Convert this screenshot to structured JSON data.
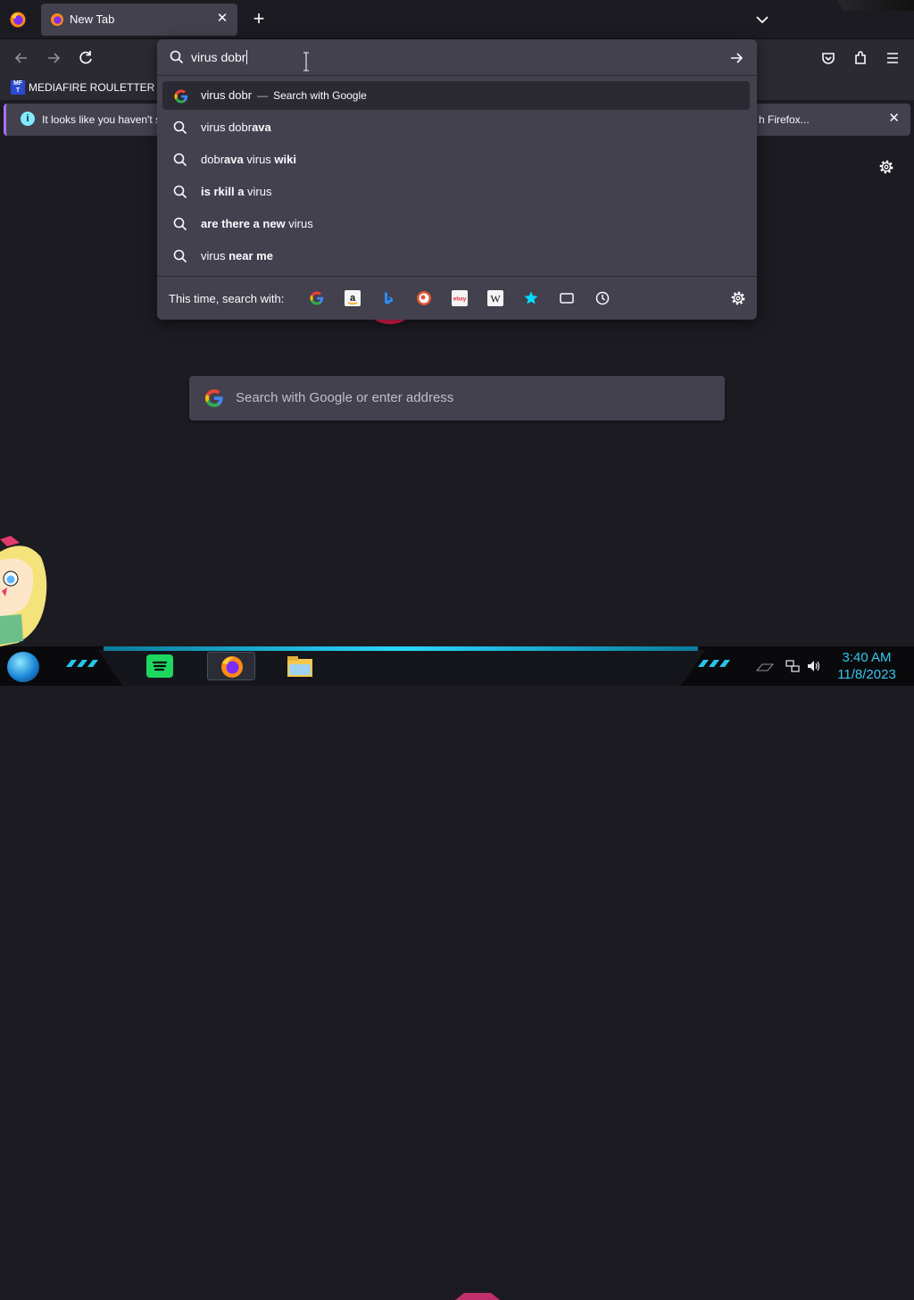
{
  "tabs": [
    {
      "title": "New Tab"
    }
  ],
  "bookmarks": [
    {
      "label": "MEDIAFIRE ROULETTER",
      "icon_text": "MF T"
    }
  ],
  "notification": {
    "text": "It looks like you haven't s",
    "action": "h Firefox..."
  },
  "urlbar": {
    "input_value": "virus dobr",
    "suggestions": [
      {
        "icon": "google-icon",
        "segments": [
          {
            "t": "virus dobr",
            "b": false
          }
        ],
        "action": "Search with Google",
        "selected": true
      },
      {
        "icon": "search-icon",
        "segments": [
          {
            "t": "virus dobr",
            "b": false
          },
          {
            "t": "ava",
            "b": true
          }
        ]
      },
      {
        "icon": "search-icon",
        "segments": [
          {
            "t": "dobr",
            "b": false
          },
          {
            "t": "ava",
            "b": true
          },
          {
            "t": " virus ",
            "b": false
          },
          {
            "t": "wiki",
            "b": true
          }
        ]
      },
      {
        "icon": "search-icon",
        "segments": [
          {
            "t": "is rkill a",
            "b": true
          },
          {
            "t": " virus",
            "b": false
          }
        ]
      },
      {
        "icon": "search-icon",
        "segments": [
          {
            "t": "are there a new",
            "b": true
          },
          {
            "t": " virus",
            "b": false
          }
        ]
      },
      {
        "icon": "search-icon",
        "segments": [
          {
            "t": "virus ",
            "b": false
          },
          {
            "t": "near me",
            "b": true
          }
        ]
      }
    ],
    "oneoff_label": "This time, search with:",
    "engines": [
      "google-icon",
      "amazon-icon",
      "bing-icon",
      "duckduckgo-icon",
      "ebay-icon",
      "wikipedia-icon",
      "bookmarks-star-icon",
      "tabs-icon",
      "history-icon"
    ]
  },
  "page": {
    "search_placeholder": "Search with Google or enter address"
  },
  "taskbar": {
    "time": "3:40 AM",
    "date": "11/8/2023"
  },
  "colors": {
    "accent": "#35c6f0",
    "panel": "#42414d",
    "toolbar": "#2b2a33",
    "bg": "#1c1b22"
  }
}
